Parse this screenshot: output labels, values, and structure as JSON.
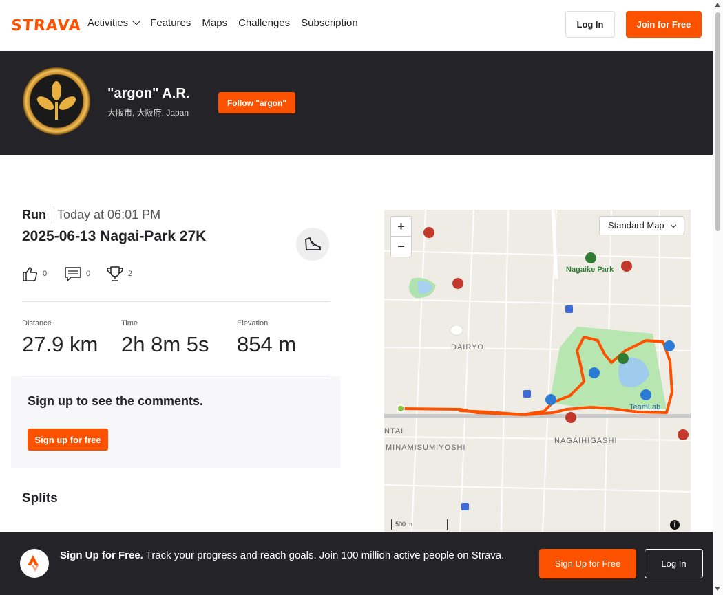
{
  "nav": {
    "logo": "STRAVA",
    "links": [
      "Activities",
      "Features",
      "Maps",
      "Challenges",
      "Subscription"
    ],
    "login": "Log In",
    "join": "Join for Free"
  },
  "athlete": {
    "name": "\"argon\" A.R.",
    "location": "大阪市, 大阪府, Japan",
    "follow": "Follow \"argon\""
  },
  "activity": {
    "type": "Run",
    "time": "Today at 06:01 PM",
    "title": "2025-06-13 Nagai-Park 27K",
    "kudos": "0",
    "comments": "0",
    "achievements": "2"
  },
  "stats": [
    {
      "label": "Distance",
      "value": "27.9 km"
    },
    {
      "label": "Time",
      "value": "2h 8m 5s"
    },
    {
      "label": "Elevation",
      "value": "854 m"
    }
  ],
  "comments_prompt": {
    "title": "Sign up to see the comments.",
    "button": "Sign up for free"
  },
  "splits_title": "Splits",
  "map": {
    "style_select": "Standard Map",
    "labels": {
      "dairyo": "DAIRYO",
      "nagaihigashi": "NAGAIHIGASHI",
      "minamisumiyoshi": "MINAMISUMIYOSHI",
      "ntai": "NTAI",
      "nagaike": "Nagaike Park",
      "teamlab": "TeamLab"
    },
    "scale": "500 m",
    "route_color": "#fc5200"
  },
  "banner": {
    "bold": "Sign Up for Free.",
    "text": " Track your progress and reach goals. Join 100 million active people on Strava.",
    "signup": "Sign Up for Free",
    "login": "Log In"
  },
  "colors": {
    "brand": "#fc5200",
    "dark": "#242428"
  }
}
